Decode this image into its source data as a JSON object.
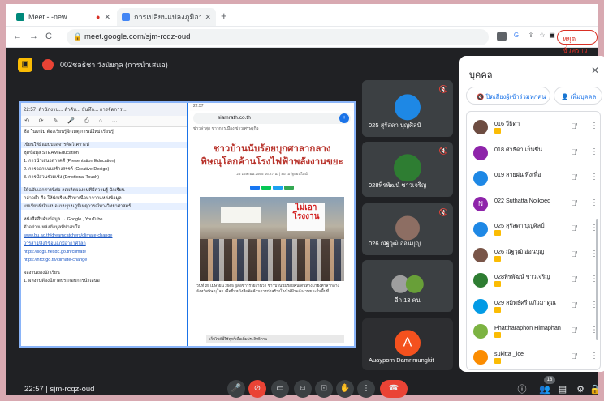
{
  "browser": {
    "tabs": [
      {
        "label": "Meet - -new",
        "recording": "●",
        "active": true,
        "favicon_color": "#00897b"
      },
      {
        "label": "การเปลี่ยนแปลงภูมิอากาศของโลก",
        "active": false,
        "favicon_color": "#4285f4"
      }
    ],
    "new_tab": "+",
    "address": "meet.google.com/sjm-rcqz-oud",
    "paused_label": "หยุดชั่วคราว",
    "nav_back": "←",
    "nav_forward": "→",
    "nav_reload": "C"
  },
  "meet": {
    "presenter_label": "002ชลธิชา วังนัยกุล (การนำเสนอ)",
    "meeting_time": "22:57",
    "meeting_code": "sjm-rcqz-oud",
    "participant_count": "18"
  },
  "shared_screen": {
    "doc": {
      "status_time": "22:57",
      "tab_text": "สำนักงาน...  ลำดับ...  บันทึก...  การจัดการ...",
      "lines": [
        "ชื่อ ในเภริม ต้องเรียนรู้ฝึกเหตุ การณ์ใหม่ เรียนรู้",
        "เขียนให้มีแบบบวลจารคิดวิเคราะห์",
        "ชุดข้อมูล  STEAM  Education",
        "1. การนำเสนอสารคดี  (Presentation  Education)",
        "2. การออกแบบสร้างสรรค์  (Creative  Design)",
        "3. การมีส่วนร่วมเชิง  (Emotional  Touch)",
        "ให้ฉบับเอกสารนี้ต่อ ลดผลิตผลงานที่มีความรู้ นักเรียน",
        "กล่าวย้ำ  คือ  ให้นักเรียนศึกษาเนื้อหาจากแหล่งข้อมูล",
        "บทเรียนที่นำเสนอแบบรูปนภูมิเหตุการณ์ทางวิทยาศาสตร์",
        "หนังสือสืบค้นข้อมูล → Google , YouTube",
        "ตัวอย่างแหล่งข้อมูลที่น่าสนใจ",
        "www.bu.ac.th/dreamcatchers/climate-change",
        "วารสาร/ลิงก์ข้อมูลภูมิอากาศโลก",
        "https://sdgs.nesdc.go.th/climate",
        "https://nrct.go.th/climate-change",
        "ผลงานของนักเรียน",
        "1. ผลงานต้องมีภาพประกอบการนำเสนอ"
      ]
    },
    "web": {
      "status": "22:57",
      "url": "siamrath.co.th",
      "tabs_text": "ข่าวล่าสุด   ข่าวการเมือง   ข่าวเศรษฐกิจ",
      "headline": "ชาวบ้านนับร้อยบุกศาลากลาง พิษณุโลกค้านโรงไฟฟ้าพลังงานขยะ",
      "byline": "25 เมษายน 2565 16:27 น. | สยามรัฐออนไลน์",
      "sign_text": "ไม่เอา โรงงาน",
      "body": "วันที่ 25 เมษายน 2565 ผู้สื่อข่าวรายงานว่า ชาวบ้านนับร้อยคนเดินทางมายังศาลากลางจังหวัดพิษณุโลก เพื่อยื่นหนังสือคัดค้านการก่อสร้างโรงไฟฟ้าพลังงานขยะในพื้นที่",
      "cookie": "เว็บไซต์นี้ใช้คุกกี้เพื่อเพิ่มประสิทธิภาพ"
    }
  },
  "tiles": [
    {
      "name": "025 สุรัสดา บุญศิลป์",
      "avatar_color": "#1e88e5"
    },
    {
      "name": "028พิรพัฒน์ ชาวเจริญ",
      "avatar_color": "#2e7d32"
    },
    {
      "name": "026 ณัฐวุฒิ อ่อนบุญ",
      "avatar_color": "#8d6e63"
    },
    {
      "name": "อีก 13 คน",
      "avatar_color": "#9e9e9e"
    },
    {
      "name": "Auayporn Damrimungkit",
      "avatar_color": "#f4511e",
      "initial": "A"
    }
  ],
  "people_panel": {
    "title": "บุคคล",
    "mute_all": "ปิดเสียงผู้เข้าร่วมทุกคน",
    "add_people": "เพิ่มบุคคล",
    "participants": [
      {
        "name": "016 วีธิดา",
        "color": "#6d4c41",
        "tag": true
      },
      {
        "name": "018 ศาธิดา เย็นชื่น",
        "color": "#8e24aa",
        "tag": false
      },
      {
        "name": "019 สายฝน พึ่งเพื่อ",
        "color": "#1e88e5",
        "tag": false
      },
      {
        "name": "022 Suthatta Noikoed",
        "color": "#8e24aa",
        "initial": "N",
        "tag": false
      },
      {
        "name": "025 สุรัสดา บุญศิลป์",
        "color": "#1e88e5",
        "tag": true
      },
      {
        "name": "026 ณัฐวุฒิ อ่อนบุญ",
        "color": "#795548",
        "tag": true
      },
      {
        "name": "028พิรพัฒน์ ชาวเจริญ",
        "color": "#2e7d32",
        "tag": true
      },
      {
        "name": "029 สมิทธ์ศรี แก้วมาดูณ",
        "color": "#039be5",
        "tag": true
      },
      {
        "name": "Phattharaphon Himaphan",
        "color": "#7cb342",
        "tag": true
      },
      {
        "name": "sukitta _ice",
        "color": "#fb8c00",
        "tag": true
      }
    ]
  },
  "icons": {
    "mic": "🎤",
    "cam": "⊘",
    "cc": "▭",
    "emoji": "☺",
    "present": "⊡",
    "hand": "✋",
    "more": "⋮",
    "end": "☎",
    "info": "ⓘ",
    "people": "👥",
    "chat": "▤",
    "activities": "⚙",
    "lock": "🔒"
  }
}
